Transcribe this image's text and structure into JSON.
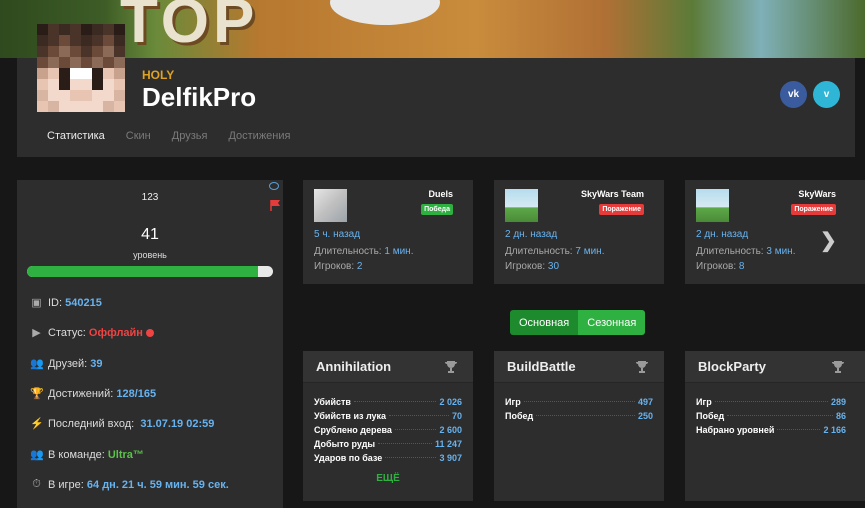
{
  "banner": {
    "title": "TOP"
  },
  "profile": {
    "rank": "HOLY",
    "nickname": "DelfikPro",
    "social": {
      "vk": "vk",
      "vimeo": "v"
    },
    "tabs": [
      "Статистика",
      "Скин",
      "Друзья",
      "Достижения"
    ],
    "active_tab": "Статистика"
  },
  "sidebar": {
    "count": "123",
    "level": "41",
    "level_label": "уровень",
    "level_progress": 0.94,
    "id_label": "ID:",
    "id_value": "540215",
    "status_label": "Статус:",
    "status_value": "Оффлайн",
    "friends_label": "Друзей:",
    "friends_value": "39",
    "achievements_label": "Достижений:",
    "achievements_value": "128/165",
    "last_login_label": "Последний вход:",
    "last_login_value": "31.07.19 02:59",
    "team_label": "В команде:",
    "team_value": "Ultra™",
    "playtime_label": "В игре:",
    "playtime_value": "64 дн. 21 ч. 59 мин. 59 сек."
  },
  "games": [
    {
      "name": "Duels",
      "result": "Победа",
      "ago": "5 ч. назад",
      "duration_label": "Длительность:",
      "duration": "1 мин.",
      "players_label": "Игроков:",
      "players": "2"
    },
    {
      "name": "SkyWars Team",
      "result": "Поражение",
      "ago": "2 дн. назад",
      "duration_label": "Длительность:",
      "duration": "7 мин.",
      "players_label": "Игроков:",
      "players": "30"
    },
    {
      "name": "SkyWars",
      "result": "Поражение",
      "ago": "2 дн. назад",
      "duration_label": "Длительность:",
      "duration": "3 мин.",
      "players_label": "Игроков:",
      "players": "8"
    }
  ],
  "toggle": {
    "main": "Основная",
    "season": "Сезонная"
  },
  "stats": [
    {
      "title": "Annihilation",
      "rows": [
        {
          "k": "Убийств",
          "v": "2 026"
        },
        {
          "k": "Убийств из лука",
          "v": "70"
        },
        {
          "k": "Срублено дерева",
          "v": "2 600"
        },
        {
          "k": "Добыто руды",
          "v": "11 247"
        },
        {
          "k": "Ударов по базе",
          "v": "3 907"
        }
      ],
      "more": "ЕЩЁ"
    },
    {
      "title": "BuildBattle",
      "rows": [
        {
          "k": "Игр",
          "v": "497"
        },
        {
          "k": "Побед",
          "v": "250"
        }
      ]
    },
    {
      "title": "BlockParty",
      "rows": [
        {
          "k": "Игр",
          "v": "289"
        },
        {
          "k": "Побед",
          "v": "86"
        },
        {
          "k": "Набрано уровней",
          "v": "2 166"
        }
      ]
    }
  ],
  "colors": {
    "accent_blue": "#67b3f0",
    "win": "#2fb142",
    "lose": "#e63b3b",
    "rank_gold": "#e0a320"
  }
}
